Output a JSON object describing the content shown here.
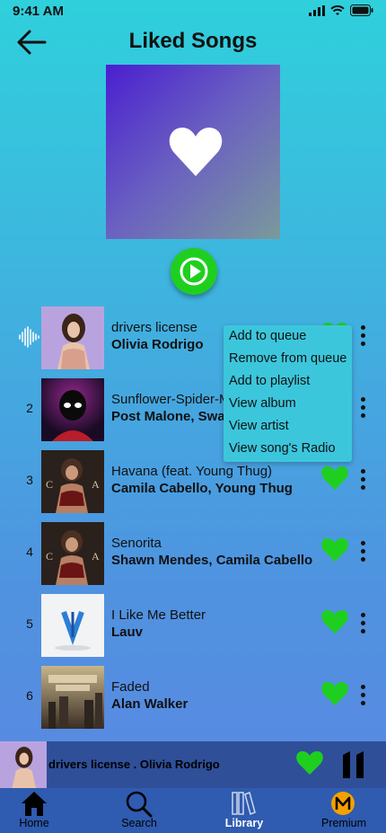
{
  "status_bar": {
    "time": "9:41 AM"
  },
  "header": {
    "title": "Liked Songs"
  },
  "tracks": [
    {
      "number": "",
      "title": "drivers license",
      "artist": "Olivia Rodrigo",
      "playing": true
    },
    {
      "number": "2",
      "title": "Sunflower-Spider-Man",
      "artist": "Post Malone, Swae Lee"
    },
    {
      "number": "3",
      "title": "Havana (feat. Young Thug)",
      "artist": "Camila Cabello, Young Thug"
    },
    {
      "number": "4",
      "title": "Senorita",
      "artist": "Shawn Mendes, Camila Cabello"
    },
    {
      "number": "5",
      "title": "I Like Me Better",
      "artist": "Lauv"
    },
    {
      "number": "6",
      "title": "Faded",
      "artist": "Alan Walker"
    }
  ],
  "context_menu": {
    "items": [
      "Add to queue",
      "Remove from queue",
      "Add to playlist",
      "View album",
      "View artist",
      "View song's Radio"
    ]
  },
  "now_playing": {
    "label": "drivers license . Olivia Rodrigo"
  },
  "bottom_nav": {
    "items": [
      {
        "label": "Home",
        "icon": "home-icon"
      },
      {
        "label": "Search",
        "icon": "search-icon"
      },
      {
        "label": "Library",
        "icon": "library-icon",
        "active": true
      },
      {
        "label": "Premium",
        "icon": "premium-icon"
      }
    ]
  },
  "colors": {
    "accent_green": "#1fcf1f",
    "menu_bg": "#3cc6dc",
    "player_bg": "#2f4f99",
    "nav_bg": "#2f5bb0"
  }
}
